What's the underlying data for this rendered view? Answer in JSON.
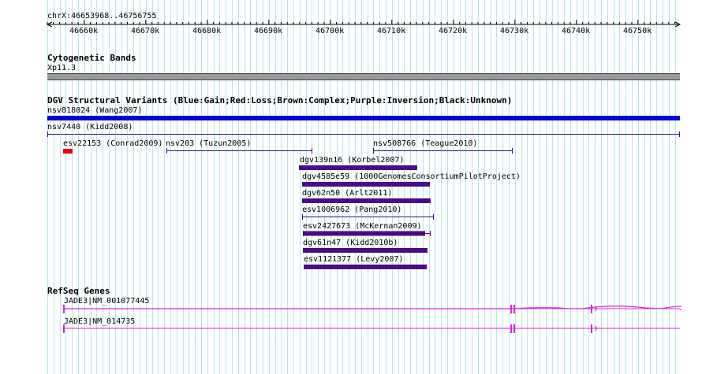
{
  "header": {
    "position": "chrX:46653968..46756755"
  },
  "ruler": {
    "labels": [
      "46660k",
      "46670k",
      "46680k",
      "46690k",
      "46700k",
      "46710k",
      "46720k",
      "46730k",
      "46740k",
      "46750k"
    ]
  },
  "cytoband": {
    "title": "Cytogenetic Bands",
    "band": "Xp11.3"
  },
  "dgv": {
    "title": "DGV Structural Variants (Blue:Gain;Red:Loss;Brown:Complex;Purple:Inversion;Black:Unknown)",
    "features": [
      {
        "label": "nsv818024 (Wang2007)",
        "color": "#0000dd"
      },
      {
        "label": "nsv7440 (Kidd2008)",
        "color": "#3a0a8a"
      },
      {
        "label": "esv22153 (Conrad2009)",
        "color": "#ee0000"
      },
      {
        "label": "nsv203 (Tuzun2005)",
        "color": "#3a0a8a"
      },
      {
        "label": "nsv508766 (Teague2010)",
        "color": "#3a0a8a"
      },
      {
        "label": "dgv139n16 (Korbel2007)",
        "color": "#4b0a8a"
      },
      {
        "label": "dgv4585e59 (1000GenomesConsortiumPilotProject)",
        "color": "#4b0a8a"
      },
      {
        "label": "dgv62n50 (Arlt2011)",
        "color": "#4b0a8a"
      },
      {
        "label": "esv1006962 (Pang2010)",
        "color": "#3a0a8a"
      },
      {
        "label": "esv2427673 (McKernan2009)",
        "color": "#4b0a8a"
      },
      {
        "label": "dgv61n47 (Kidd2010b)",
        "color": "#4b0a8a"
      },
      {
        "label": "esv1121377 (Levy2007)",
        "color": "#4b0a8a"
      }
    ]
  },
  "refseq": {
    "title": "RefSeq Genes",
    "genes": [
      {
        "label": "JADE3|NM_001077445",
        "color": "#dd22dd"
      },
      {
        "label": "JADE3|NM_014735",
        "color": "#dd22dd"
      }
    ]
  },
  "colors": {
    "grid": "#b7e6ee",
    "cytoband": "#999999"
  }
}
